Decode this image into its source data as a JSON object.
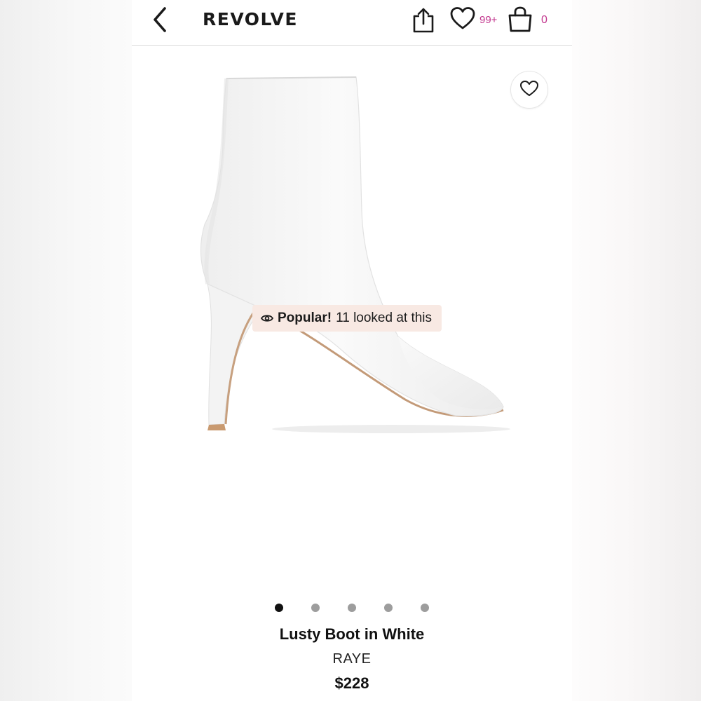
{
  "header": {
    "brand": "REVOLVE",
    "wishlist_count": "99+",
    "bag_count": "0",
    "accent_color": "#c2358d"
  },
  "icons": {
    "back": "chevron-left-icon",
    "share": "share-icon",
    "wishlist": "heart-icon",
    "bag": "shopping-bag-icon",
    "favorite": "heart-icon",
    "popular": "eye-icon"
  },
  "popular_badge": {
    "strong_label": "Popular!",
    "text": "11 looked at this",
    "background": "#f8e9e3"
  },
  "carousel": {
    "total": 5,
    "active_index": 0
  },
  "product": {
    "title": "Lusty Boot in White",
    "designer": "RAYE",
    "price": "$228"
  }
}
